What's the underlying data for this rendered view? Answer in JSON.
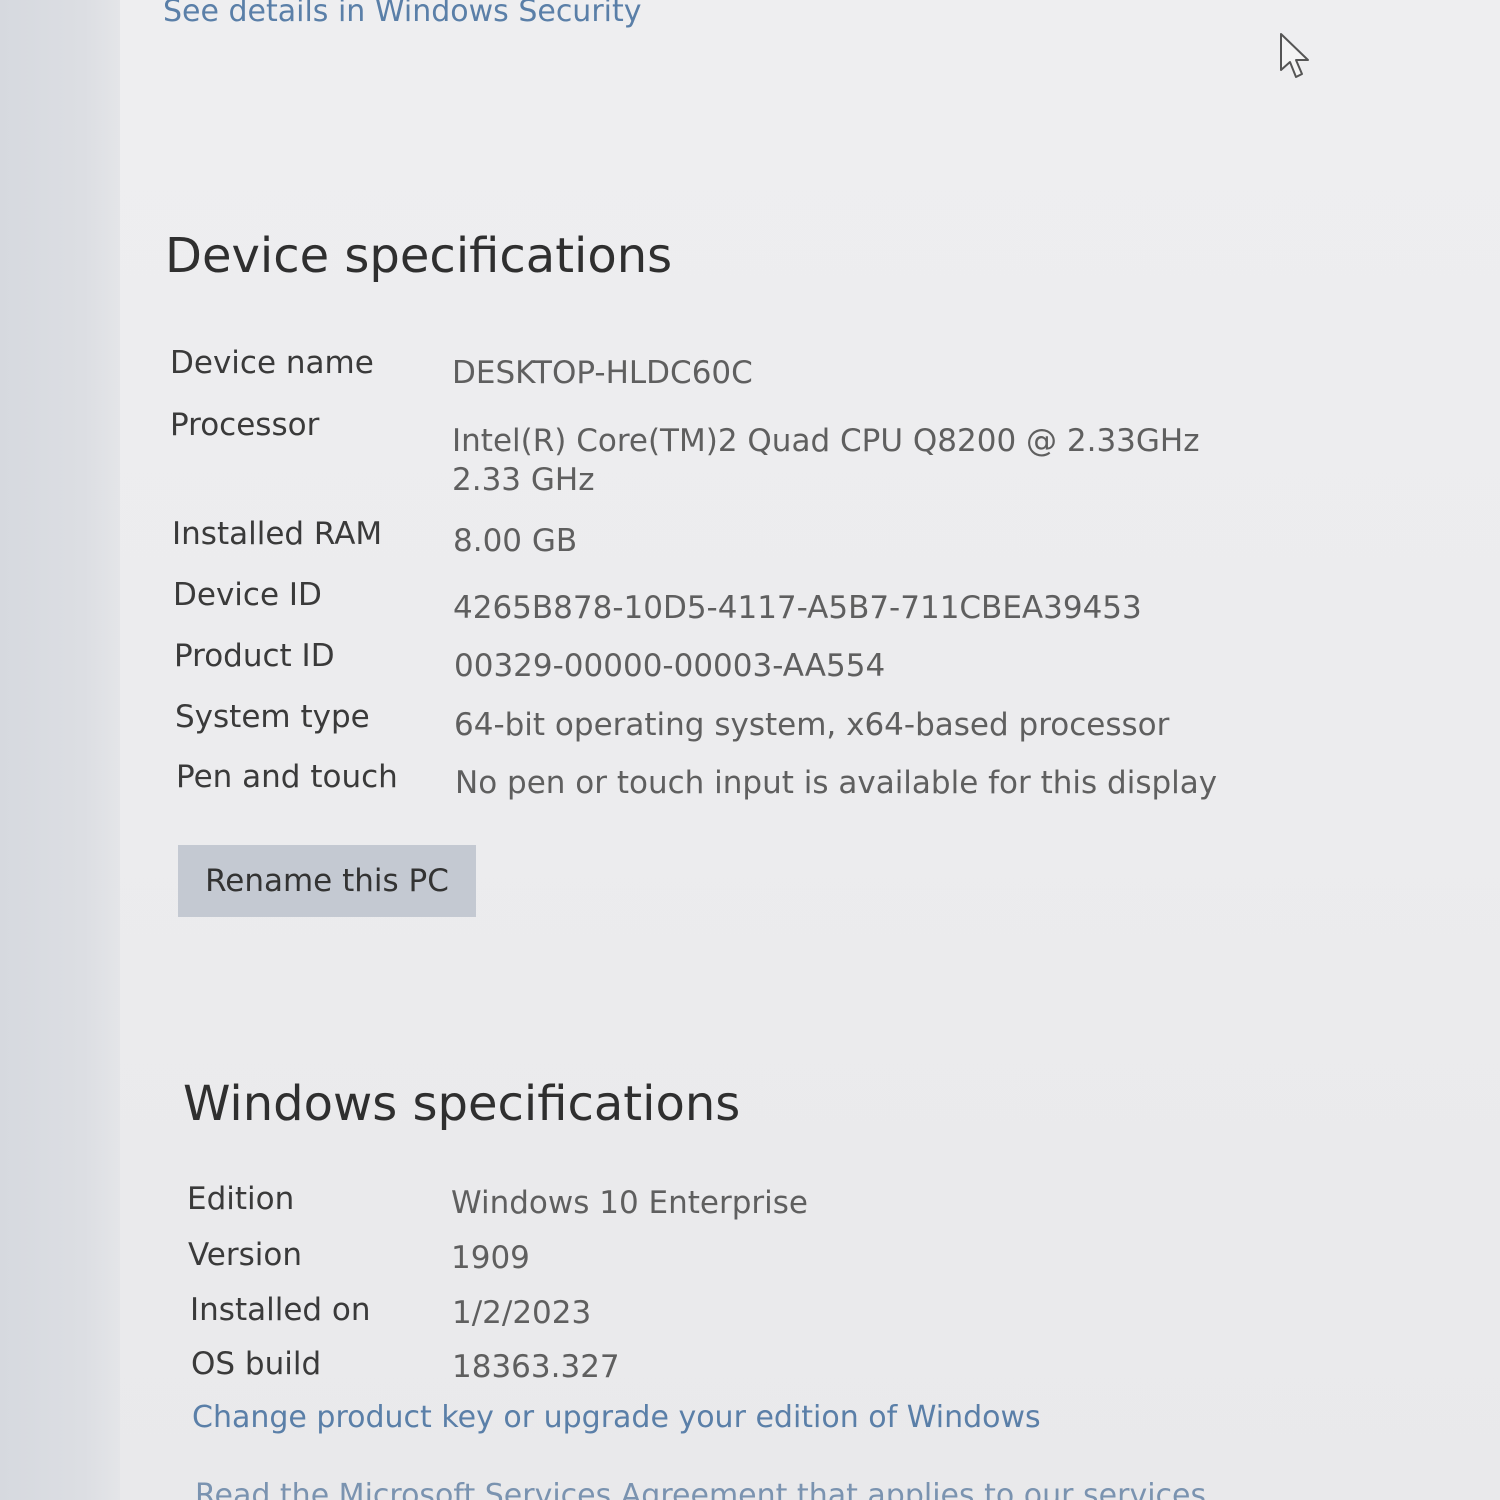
{
  "links": {
    "security": "See details in Windows Security",
    "product_key": "Change product key or upgrade your edition of Windows",
    "services_agreement": "Read the Microsoft Services Agreement that applies to our services"
  },
  "device": {
    "title": "Device specifications",
    "rows": [
      {
        "label": "Device name",
        "value": "DESKTOP-HLDC60C"
      },
      {
        "label": "Processor",
        "value": "Intel(R) Core(TM)2 Quad  CPU   Q8200  @ 2.33GHz",
        "value2": "2.33 GHz"
      },
      {
        "label": "Installed RAM",
        "value": "8.00 GB"
      },
      {
        "label": "Device ID",
        "value": "4265B878-10D5-4117-A5B7-711CBEA39453"
      },
      {
        "label": "Product ID",
        "value": "00329-00000-00003-AA554"
      },
      {
        "label": "System type",
        "value": "64-bit operating system, x64-based processor"
      },
      {
        "label": "Pen and touch",
        "value": "No pen or touch input is available for this display"
      }
    ],
    "rename_button": "Rename this PC"
  },
  "windows": {
    "title": "Windows specifications",
    "rows": [
      {
        "label": "Edition",
        "value": "Windows 10 Enterprise"
      },
      {
        "label": "Version",
        "value": "1909"
      },
      {
        "label": "Installed on",
        "value": "1/2/2023"
      },
      {
        "label": "OS build",
        "value": "18363.327"
      }
    ]
  },
  "icons": {
    "cursor": "mouse-pointer-icon"
  }
}
